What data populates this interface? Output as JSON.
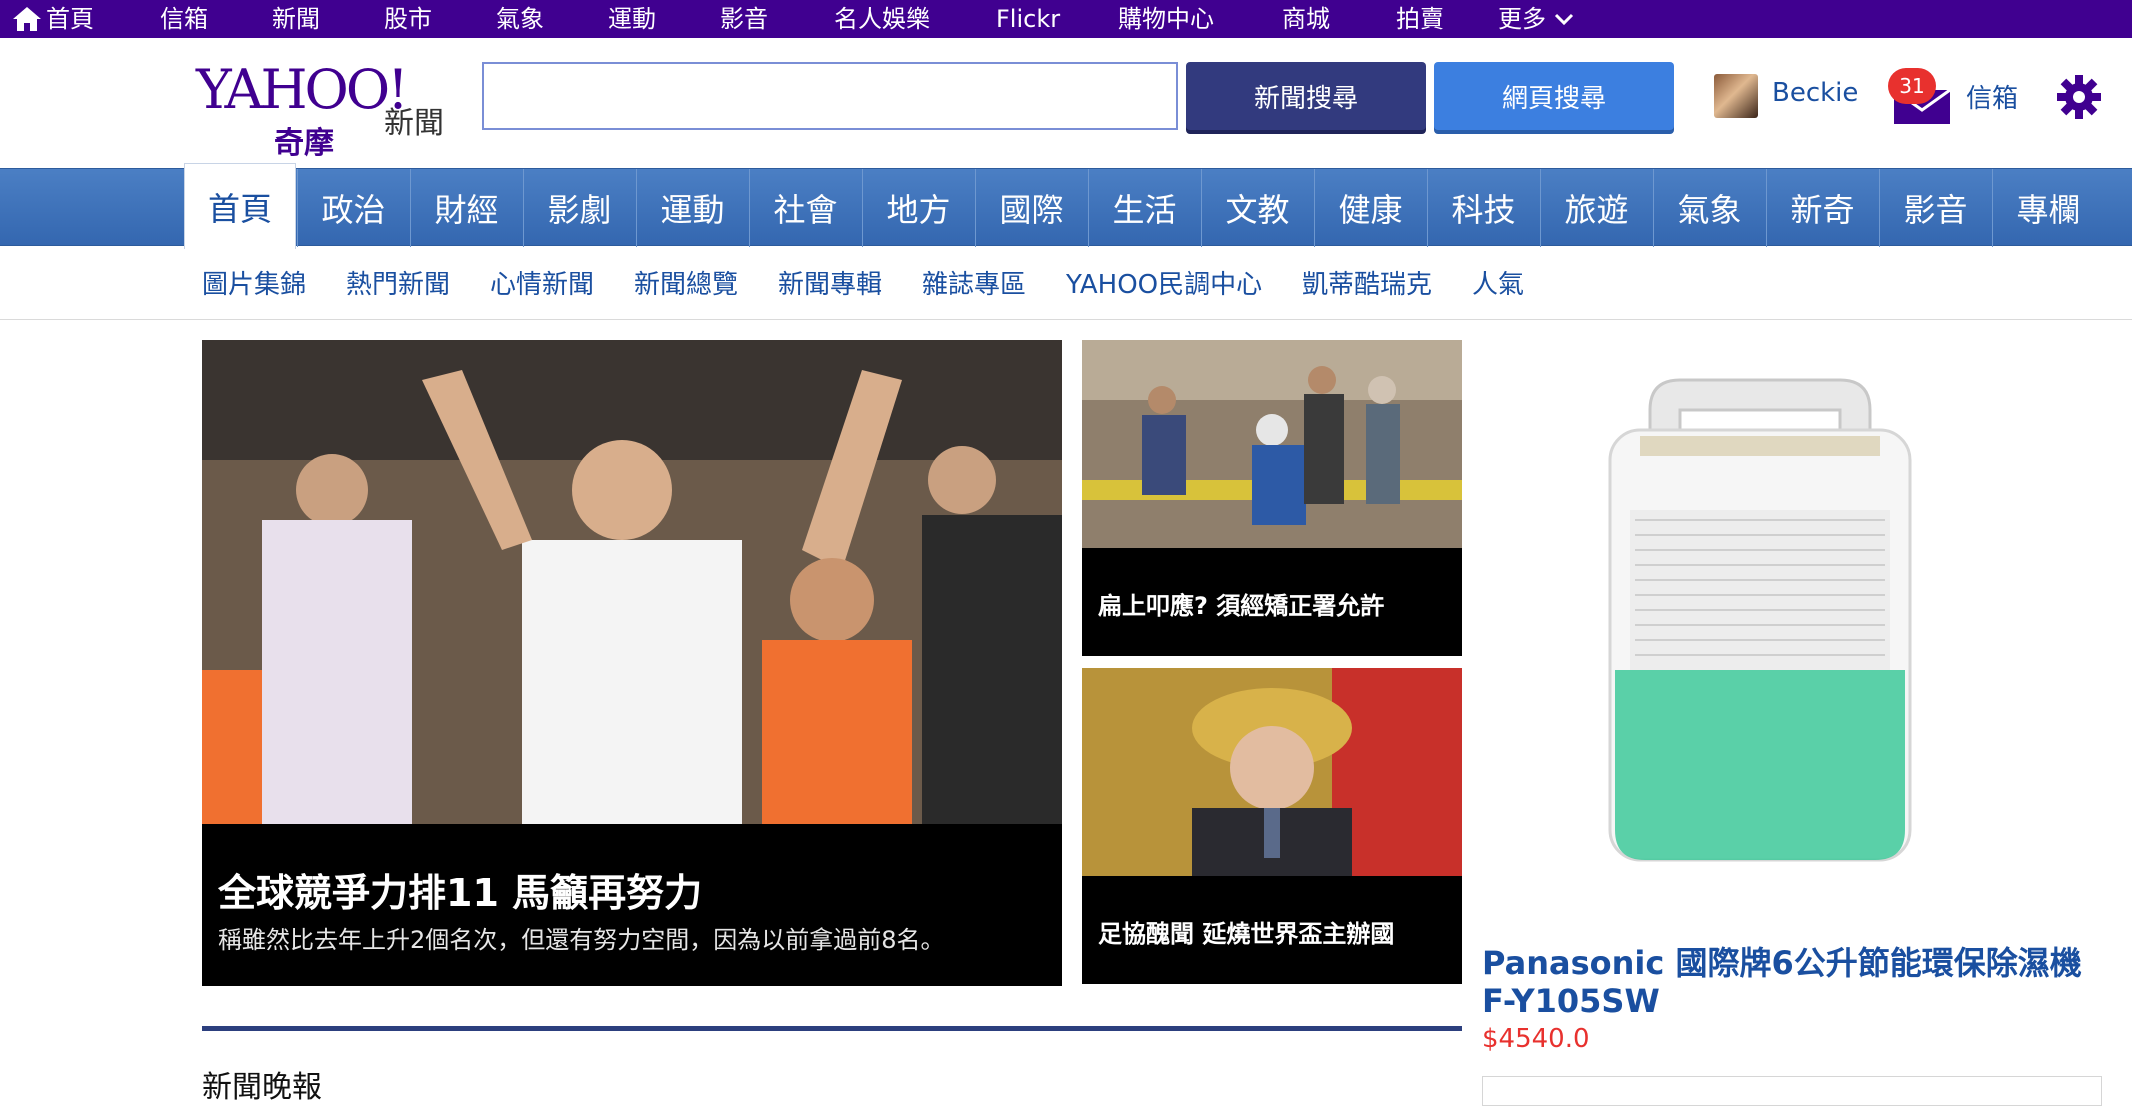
{
  "topbar": {
    "items": [
      "首頁",
      "信箱",
      "新聞",
      "股市",
      "氣象",
      "運動",
      "影音",
      "名人娛樂",
      "Flickr",
      "購物中心",
      "商城",
      "拍賣",
      "更多"
    ],
    "icons": {
      "home": "home-icon",
      "more": "chevron-down-icon"
    }
  },
  "header": {
    "logo_brand": "YAHOO!",
    "logo_sub": "奇摩",
    "logo_section": "新聞",
    "search": {
      "value": "",
      "placeholder": ""
    },
    "news_search_label": "新聞搜尋",
    "web_search_label": "網頁搜尋",
    "user_name": "Beckie",
    "mail_count": "31",
    "mail_label": "信箱"
  },
  "mainnav": {
    "tabs": [
      "首頁",
      "政治",
      "財經",
      "影劇",
      "運動",
      "社會",
      "地方",
      "國際",
      "生活",
      "文教",
      "健康",
      "科技",
      "旅遊",
      "氣象",
      "新奇",
      "影音",
      "專欄"
    ],
    "active_index": 0
  },
  "subnav": {
    "items": [
      "圖片集錦",
      "熱門新聞",
      "心情新聞",
      "新聞總覽",
      "新聞專輯",
      "雜誌專區",
      "YAHOO民調中心",
      "凱蒂酷瑞克",
      "人氣"
    ]
  },
  "stories": {
    "hero": {
      "title": "全球競爭力排11 馬籲再努力",
      "desc": "稱雖然比去年上升2個名次，但還有努力空間，因為以前拿過前8名。"
    },
    "side": [
      {
        "caption": "扁上叩應? 須經矯正署允許"
      },
      {
        "caption": "足協醜聞 延燒世界盃主辦國"
      }
    ]
  },
  "section": {
    "title": "新聞晚報"
  },
  "ad": {
    "title": "Panasonic 國際牌6公升節能環保除濕機 F-Y105SW",
    "price": "$4540.0"
  },
  "colors": {
    "topbar": "#400090",
    "nav": "#3467b0",
    "link": "#1a4fa0",
    "price": "#e8312e",
    "badge": "#e8312e"
  }
}
